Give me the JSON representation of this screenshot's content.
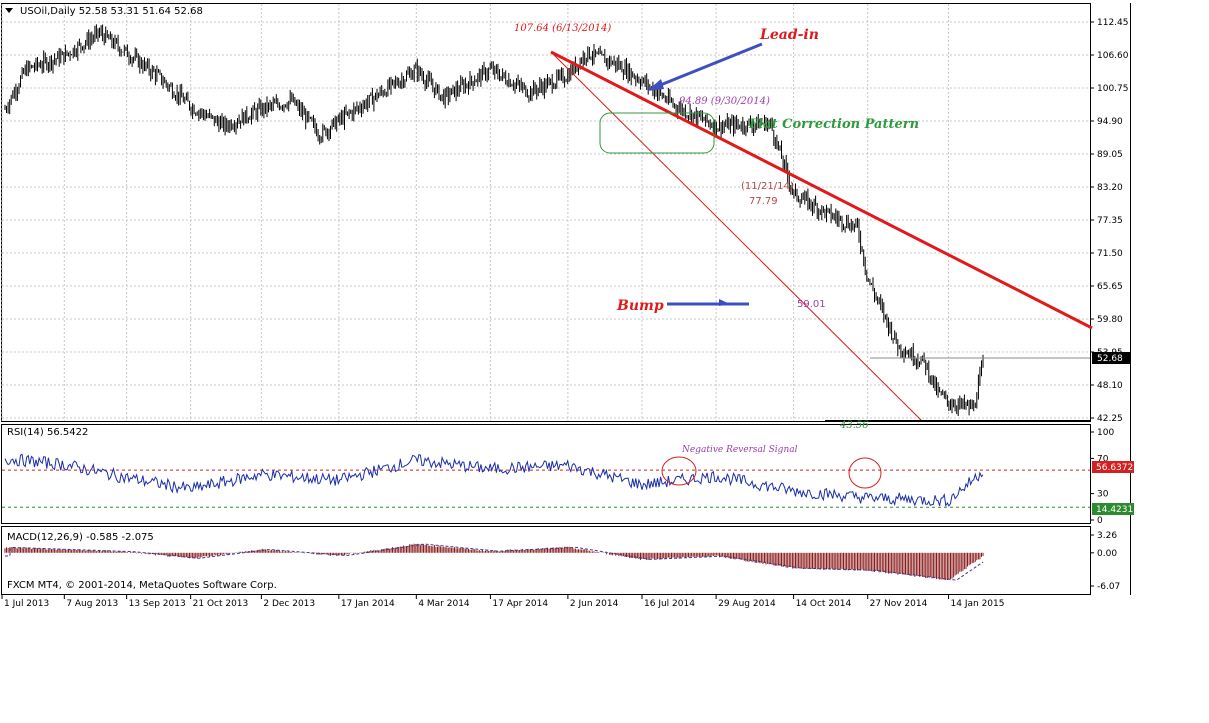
{
  "symbol_line": "USOil,Daily  52.58 53.31 51.64 52.68",
  "watermark": "FXCM MT4, © 2001-2014, MetaQuotes Software Corp.",
  "colors": {
    "bearish_trendline": "#e01a1a",
    "blue_arrow": "#3e4fbf",
    "green_pattern": "#2e9a3e",
    "purple_label": "#9a3fa8",
    "rsi_line": "#1a2fa8",
    "macd_bars": "#8b1a1a",
    "price_candles": "#000000"
  },
  "chart_data": {
    "type": "candlestick",
    "main": {
      "y_ticks": [
        "112.45",
        "106.60",
        "100.75",
        "94.90",
        "89.05",
        "83.20",
        "77.35",
        "71.50",
        "65.65",
        "59.80",
        "53.95",
        "48.10",
        "42.25"
      ],
      "ylim": [
        42.25,
        112.45
      ],
      "current_price": "52.68",
      "x_ticks": [
        "1 Jul 2013",
        "7 Aug 2013",
        "13 Sep 2013",
        "21 Oct 2013",
        "2 Dec 2013",
        "17 Jan 2014",
        "4 Mar 2014",
        "17 Apr 2014",
        "2 Jun 2014",
        "16 Jul 2014",
        "29 Aug 2014",
        "14 Oct 2014",
        "27 Nov 2014",
        "14 Jan 2015"
      ],
      "price_path": [
        {
          "date": "1 Jul 2013",
          "close": 96.0
        },
        {
          "date": "15 Jul 2013",
          "close": 104.0
        },
        {
          "date": "7 Aug 2013",
          "close": 106.5
        },
        {
          "date": "28 Aug 2013",
          "close": 110.5
        },
        {
          "date": "13 Sep 2013",
          "close": 107.0
        },
        {
          "date": "1 Oct 2013",
          "close": 103.0
        },
        {
          "date": "21 Oct 2013",
          "close": 97.5
        },
        {
          "date": "10 Nov 2013",
          "close": 94.0
        },
        {
          "date": "2 Dec 2013",
          "close": 97.0
        },
        {
          "date": "20 Dec 2013",
          "close": 98.5
        },
        {
          "date": "6 Jan 2014",
          "close": 92.5
        },
        {
          "date": "17 Jan 2014",
          "close": 95.0
        },
        {
          "date": "4 Mar 2014",
          "close": 104.0
        },
        {
          "date": "20 Mar 2014",
          "close": 99.0
        },
        {
          "date": "17 Apr 2014",
          "close": 104.0
        },
        {
          "date": "10 May 2014",
          "close": 100.0
        },
        {
          "date": "2 Jun 2014",
          "close": 103.0
        },
        {
          "date": "13 Jun 2014",
          "close": 107.0
        },
        {
          "date": "1 Jul 2014",
          "close": 105.0
        },
        {
          "date": "16 Jul 2014",
          "close": 102.0
        },
        {
          "date": "5 Aug 2014",
          "close": 97.5
        },
        {
          "date": "29 Aug 2014",
          "close": 94.0
        },
        {
          "date": "30 Sep 2014",
          "close": 94.5
        },
        {
          "date": "14 Oct 2014",
          "close": 82.0
        },
        {
          "date": "3 Nov 2014",
          "close": 78.5
        },
        {
          "date": "21 Nov 2014",
          "close": 76.0
        },
        {
          "date": "27 Nov 2014",
          "close": 67.0
        },
        {
          "date": "15 Dec 2014",
          "close": 55.0
        },
        {
          "date": "31 Dec 2014",
          "close": 52.0
        },
        {
          "date": "7 Jan 2015",
          "close": 47.0
        },
        {
          "date": "14 Jan 2015",
          "close": 45.0
        },
        {
          "date": "29 Jan 2015",
          "close": 44.0
        },
        {
          "date": "4 Feb 2015",
          "close": 52.68
        }
      ],
      "annotations": [
        {
          "text": "107.64  (6/13/2014)",
          "role": "peak"
        },
        {
          "text": "Lead-in",
          "role": "title"
        },
        {
          "text": "94.89  (9/30/2014)",
          "role": "pivot"
        },
        {
          "text": "Flat Correction Pattern",
          "role": "pattern"
        },
        {
          "text": "(11/21/14)",
          "role": "date"
        },
        {
          "text": "77.79",
          "role": "price"
        },
        {
          "text": "Bump",
          "role": "title"
        },
        {
          "text": "59.01",
          "role": "price"
        },
        {
          "text": "43.56",
          "role": "low"
        }
      ]
    },
    "rsi": {
      "label": "RSI(14) 56.5422",
      "y_ticks": [
        "100",
        "70",
        "30",
        "0"
      ],
      "ylim": [
        0,
        100
      ],
      "levels": [
        {
          "value": 56.6372,
          "label": "56.6372"
        },
        {
          "value": 14.4231,
          "label": "14.4231"
        }
      ],
      "annotation": "Negative Reversal Signal",
      "path": [
        {
          "date": "1 Jul 2013",
          "value": 70
        },
        {
          "date": "7 Aug 2013",
          "value": 63
        },
        {
          "date": "13 Sep 2013",
          "value": 48
        },
        {
          "date": "21 Oct 2013",
          "value": 35
        },
        {
          "date": "2 Dec 2013",
          "value": 52
        },
        {
          "date": "17 Jan 2014",
          "value": 45
        },
        {
          "date": "4 Mar 2014",
          "value": 68
        },
        {
          "date": "17 Apr 2014",
          "value": 58
        },
        {
          "date": "2 Jun 2014",
          "value": 62
        },
        {
          "date": "16 Jul 2014",
          "value": 40
        },
        {
          "date": "29 Aug 2014",
          "value": 50
        },
        {
          "date": "14 Oct 2014",
          "value": 33
        },
        {
          "date": "27 Nov 2014",
          "value": 25
        },
        {
          "date": "14 Jan 2015",
          "value": 22
        },
        {
          "date": "4 Feb 2015",
          "value": 56.5
        }
      ]
    },
    "macd": {
      "label": "MACD(12,26,9) -0.585 -2.075",
      "y_ticks": [
        "3.26",
        "0.00",
        "-6.07"
      ],
      "ylim": [
        -6.07,
        3.26
      ],
      "path": [
        {
          "date": "1 Jul 2013",
          "value": 1.0
        },
        {
          "date": "13 Sep 2013",
          "value": 0.2
        },
        {
          "date": "21 Oct 2013",
          "value": -1.0
        },
        {
          "date": "2 Dec 2013",
          "value": 0.6
        },
        {
          "date": "17 Jan 2014",
          "value": -0.5
        },
        {
          "date": "4 Mar 2014",
          "value": 1.6
        },
        {
          "date": "17 Apr 2014",
          "value": 0.3
        },
        {
          "date": "2 Jun 2014",
          "value": 1.0
        },
        {
          "date": "16 Jul 2014",
          "value": -1.2
        },
        {
          "date": "29 Aug 2014",
          "value": -0.6
        },
        {
          "date": "14 Oct 2014",
          "value": -2.8
        },
        {
          "date": "27 Nov 2014",
          "value": -3.2
        },
        {
          "date": "14 Jan 2015",
          "value": -5.0
        },
        {
          "date": "4 Feb 2015",
          "value": -0.585
        }
      ]
    }
  }
}
